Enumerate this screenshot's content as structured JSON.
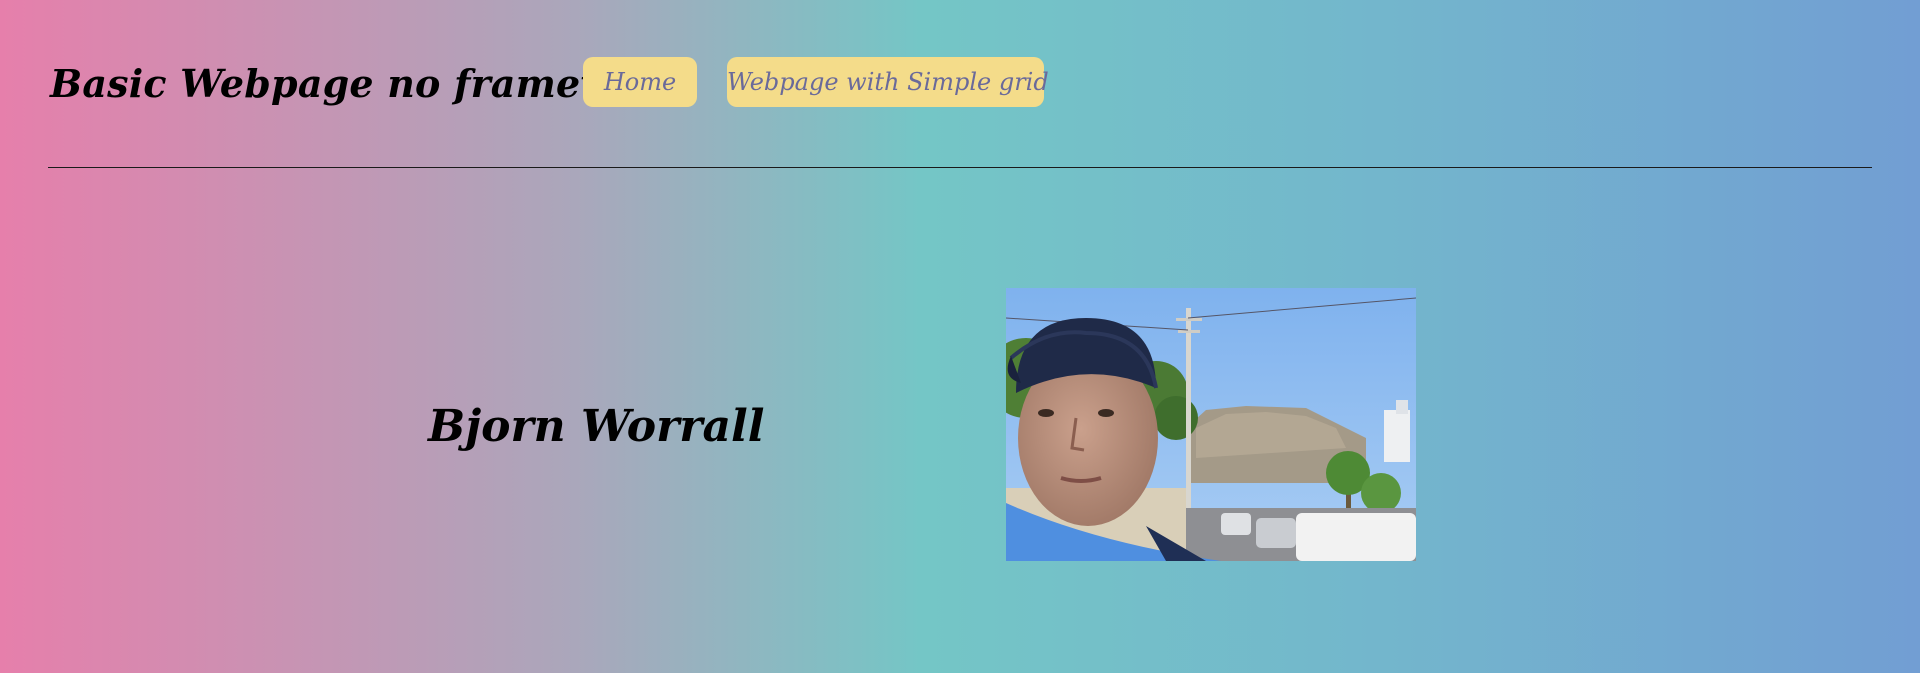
{
  "header": {
    "title": "Basic Webpage no framework",
    "nav": [
      {
        "label": "Home"
      },
      {
        "label": "Webpage with Simple grid"
      }
    ]
  },
  "main": {
    "name": "Bjorn Worrall",
    "photo": {
      "icon": "portrait-photo"
    }
  },
  "colors": {
    "gradient_start": "#e67fab",
    "gradient_mid": "#74c6c6",
    "gradient_end": "#729ed3",
    "button_bg": "#f4dc8a",
    "button_text": "#6a6a9a"
  }
}
